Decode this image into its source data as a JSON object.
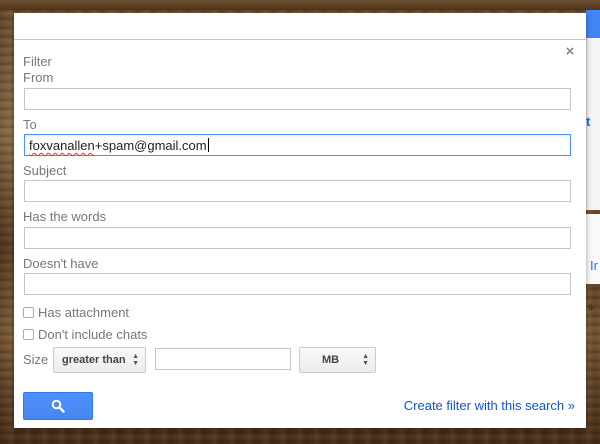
{
  "dialog": {
    "title": "Filter",
    "close_glyph": "×",
    "fields": {
      "from": {
        "label": "From",
        "value": ""
      },
      "to": {
        "label": "To",
        "value_underlined": "foxvanallen",
        "value_rest": "+spam@gmail.com"
      },
      "subject": {
        "label": "Subject",
        "value": ""
      },
      "has_words": {
        "label": "Has the words",
        "value": ""
      },
      "doesnt_have": {
        "label": "Doesn't have",
        "value": ""
      }
    },
    "checkboxes": {
      "has_attachment": {
        "label": "Has attachment",
        "checked": false
      },
      "dont_include_chats": {
        "label": "Don't include chats",
        "checked": false
      }
    },
    "size": {
      "label": "Size",
      "operator": "greater than",
      "value": "",
      "unit": "MB"
    },
    "search_button_icon": "search-icon",
    "create_filter_link": "Create filter with this search »"
  },
  "background": {
    "partial_letter_top": "t",
    "partial_letter_mid": "Ir",
    "partial_text": "s"
  },
  "colors": {
    "accent_blue": "#4d90fe",
    "link_blue": "#1155cc",
    "label_gray": "#777777"
  }
}
